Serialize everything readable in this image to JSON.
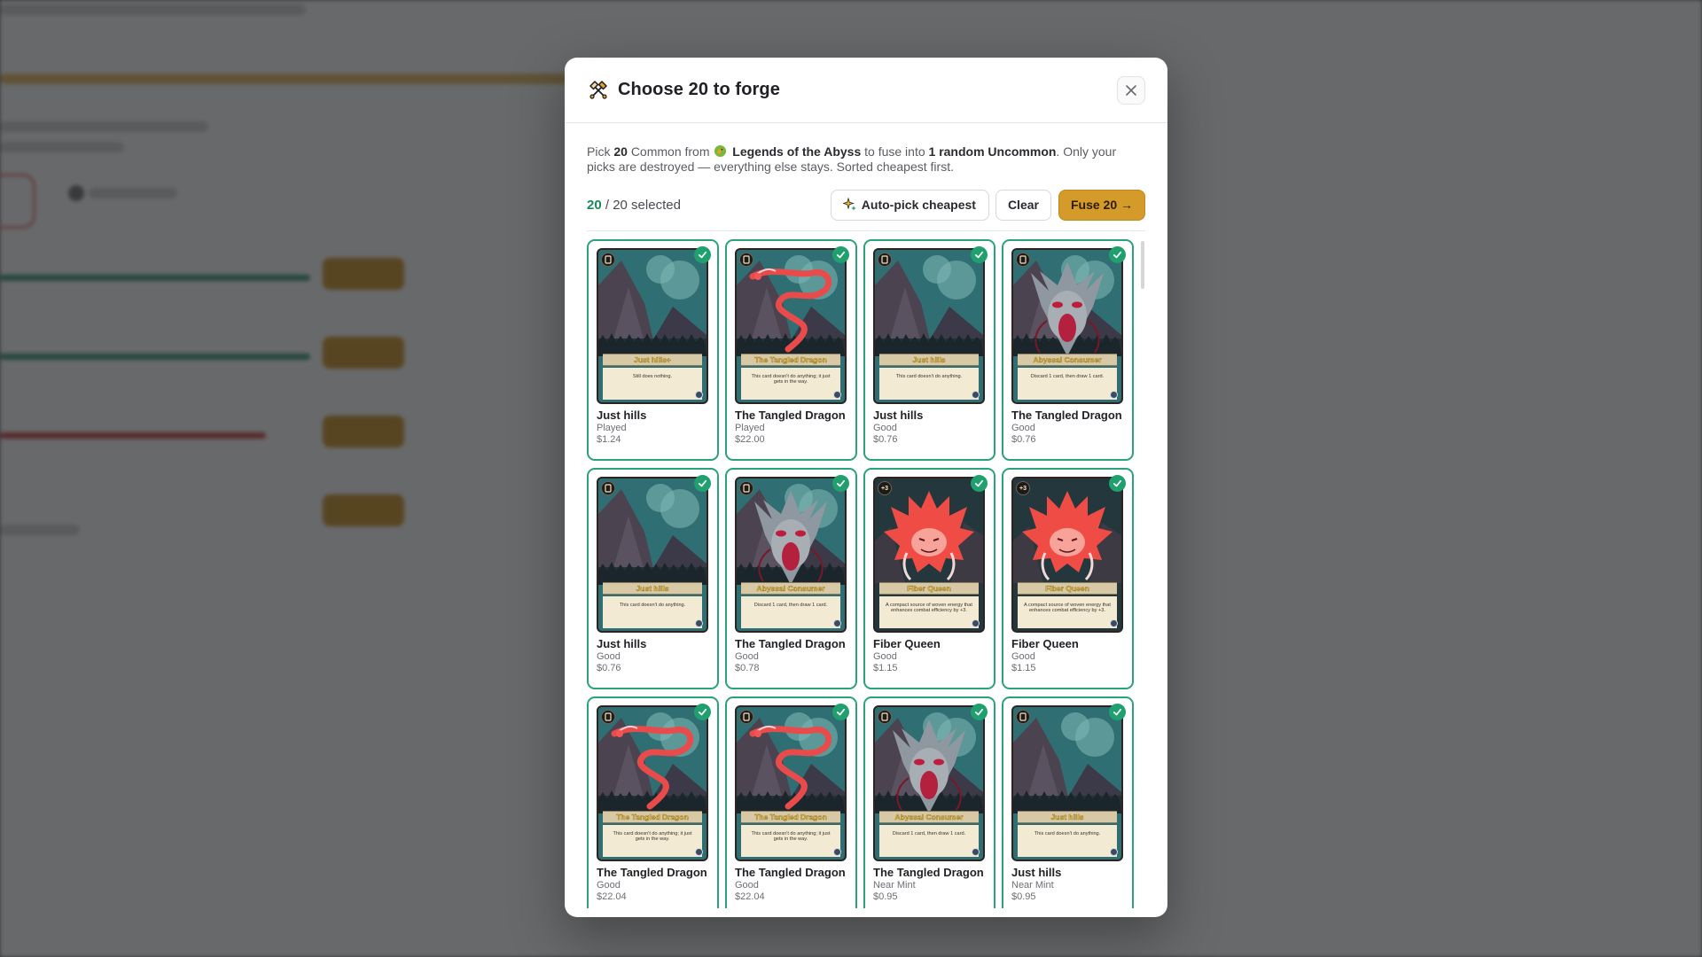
{
  "modal": {
    "title": "Choose 20 to forge",
    "title_icon": "crossed-hammers-icon",
    "close_icon": "close-icon",
    "description": {
      "pick_prefix": "Pick",
      "pick_count": "20",
      "rarity_from": "Common from",
      "set_icon": "dragon-set-icon",
      "set_name": "Legends of the Abyss",
      "fuse_prefix": "to fuse into",
      "fuse_result": "1 random Uncommon",
      "suffix": ". Only your picks are destroyed — everything else stays. Sorted cheapest first."
    },
    "selection": {
      "selected": "20",
      "total_text": "/ 20 selected"
    },
    "buttons": {
      "auto_pick": "Auto-pick cheapest",
      "auto_pick_icon": "sparkle-icon",
      "clear": "Clear",
      "fuse": "Fuse 20 →"
    }
  },
  "colors": {
    "accent_green": "#21a06f",
    "card_border": "#2aa27a",
    "fuse_button": "#d49a2a"
  },
  "cards": [
    {
      "name": "Just hills",
      "condition": "Played",
      "price": "$1.24",
      "art": "hills",
      "art_name": "Just hills+",
      "art_text": "Still does nothing.",
      "badge": ""
    },
    {
      "name": "The Tangled Dragon",
      "condition": "Played",
      "price": "$22.00",
      "art": "dragon",
      "art_name": "The Tangled Dragon",
      "art_text": "This card doesn't do anything; it just gets in the way.",
      "badge": ""
    },
    {
      "name": "Just hills",
      "condition": "Good",
      "price": "$0.76",
      "art": "hills",
      "art_name": "Just hills",
      "art_text": "This card doesn't do anything.",
      "badge": ""
    },
    {
      "name": "The Tangled Dragon",
      "condition": "Good",
      "price": "$0.76",
      "art": "abyssal",
      "art_name": "Abyssal Consumer",
      "art_text": "Discard 1 card, then draw 1 card.",
      "badge": ""
    },
    {
      "name": "Just hills",
      "condition": "Good",
      "price": "$0.76",
      "art": "hills",
      "art_name": "Just hills",
      "art_text": "This card doesn't do anything.",
      "badge": ""
    },
    {
      "name": "The Tangled Dragon",
      "condition": "Good",
      "price": "$0.78",
      "art": "abyssal",
      "art_name": "Abyssal Consumer",
      "art_text": "Discard 1 card, then draw 1 card.",
      "badge": ""
    },
    {
      "name": "Fiber Queen",
      "condition": "Good",
      "price": "$1.15",
      "art": "fiber",
      "art_name": "Fiber Queen",
      "art_text": "A compact source of woven energy that enhances combat efficiency by +3.",
      "badge": "+3"
    },
    {
      "name": "Fiber Queen",
      "condition": "Good",
      "price": "$1.15",
      "art": "fiber",
      "art_name": "Fiber Queen",
      "art_text": "A compact source of woven energy that enhances combat efficiency by +3.",
      "badge": "+3"
    },
    {
      "name": "The Tangled Dragon",
      "condition": "Good",
      "price": "$22.04",
      "art": "dragon",
      "art_name": "The Tangled Dragon",
      "art_text": "This card doesn't do anything; it just gets in the way.",
      "badge": ""
    },
    {
      "name": "The Tangled Dragon",
      "condition": "Good",
      "price": "$22.04",
      "art": "dragon",
      "art_name": "The Tangled Dragon",
      "art_text": "This card doesn't do anything; it just gets in the way.",
      "badge": ""
    },
    {
      "name": "The Tangled Dragon",
      "condition": "Near Mint",
      "price": "$0.95",
      "art": "abyssal",
      "art_name": "Abyssal Consumer",
      "art_text": "Discard 1 card, then draw 1 card.",
      "badge": ""
    },
    {
      "name": "Just hills",
      "condition": "Near Mint",
      "price": "$0.95",
      "art": "hills",
      "art_name": "Just hills",
      "art_text": "This card doesn't do anything.",
      "badge": ""
    }
  ]
}
